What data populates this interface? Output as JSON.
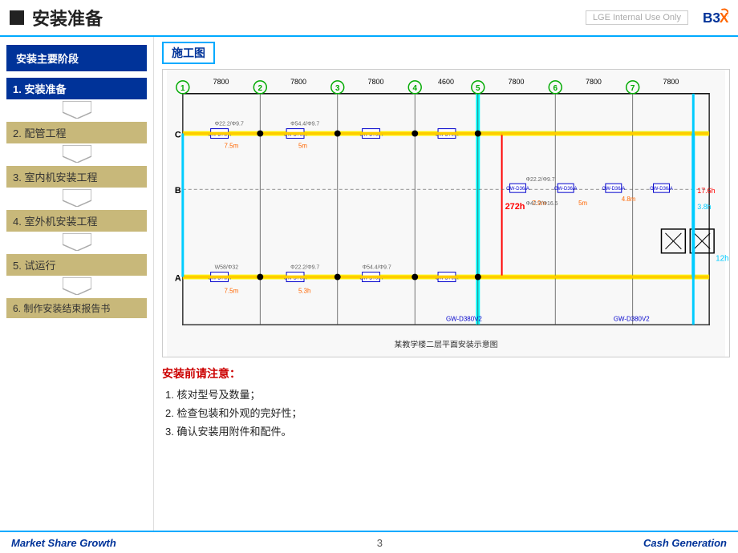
{
  "header": {
    "title": "安装准备",
    "watermark": "LGE Internal Use Only",
    "logo": "B3X"
  },
  "sidebar": {
    "title": "安装主要阶段",
    "stages": [
      {
        "id": 1,
        "label": "1. 安装准备",
        "active": true
      },
      {
        "id": 2,
        "label": "2. 配管工程",
        "active": false
      },
      {
        "id": 3,
        "label": "3. 室内机安装工程",
        "active": false
      },
      {
        "id": 4,
        "label": "4. 室外机安装工程",
        "active": false
      },
      {
        "id": 5,
        "label": "5. 试运行",
        "active": false
      },
      {
        "id": 6,
        "label": "6. 制作安装结束报告书",
        "active": false
      }
    ]
  },
  "content": {
    "drawing_label": "施工图",
    "blueprint_caption": "某教学楼二层平面安装示意图",
    "notes": {
      "title": "安装前请注意：",
      "items": [
        "1. 核对型号及数量；",
        "2. 检查包装和外观的完好性；",
        "3. 确认安装用附件和配件。"
      ]
    }
  },
  "footer": {
    "left": "Market Share Growth",
    "center": "3",
    "right": "Cash  Generation"
  }
}
